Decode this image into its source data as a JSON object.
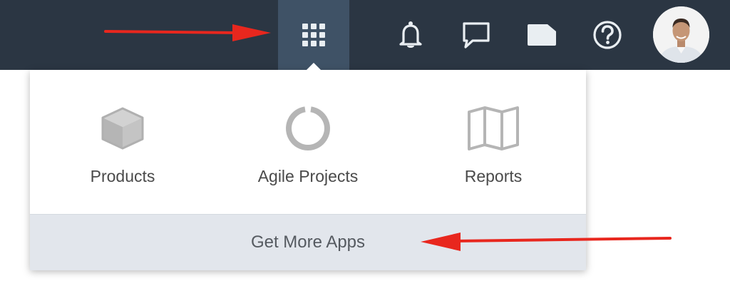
{
  "topbar": {
    "apps_icon": "grid-icon",
    "notifications_icon": "bell-icon",
    "messages_icon": "chat-bubble-icon",
    "folder_icon": "folder-icon",
    "help_icon": "help-icon"
  },
  "apps_menu": {
    "items": [
      {
        "label": "Products",
        "icon": "cube-icon"
      },
      {
        "label": "Agile Projects",
        "icon": "progress-ring-icon"
      },
      {
        "label": "Reports",
        "icon": "map-icon"
      }
    ],
    "get_more_label": "Get More Apps"
  },
  "annotations": {
    "arrow_color": "#e8271e"
  },
  "colors": {
    "topbar_bg": "#2b3643",
    "active_button_bg": "#3f5266",
    "icon_white": "#e9eef2",
    "app_icon_gray": "#b5b5b5",
    "footer_bg": "#e2e6ec"
  }
}
